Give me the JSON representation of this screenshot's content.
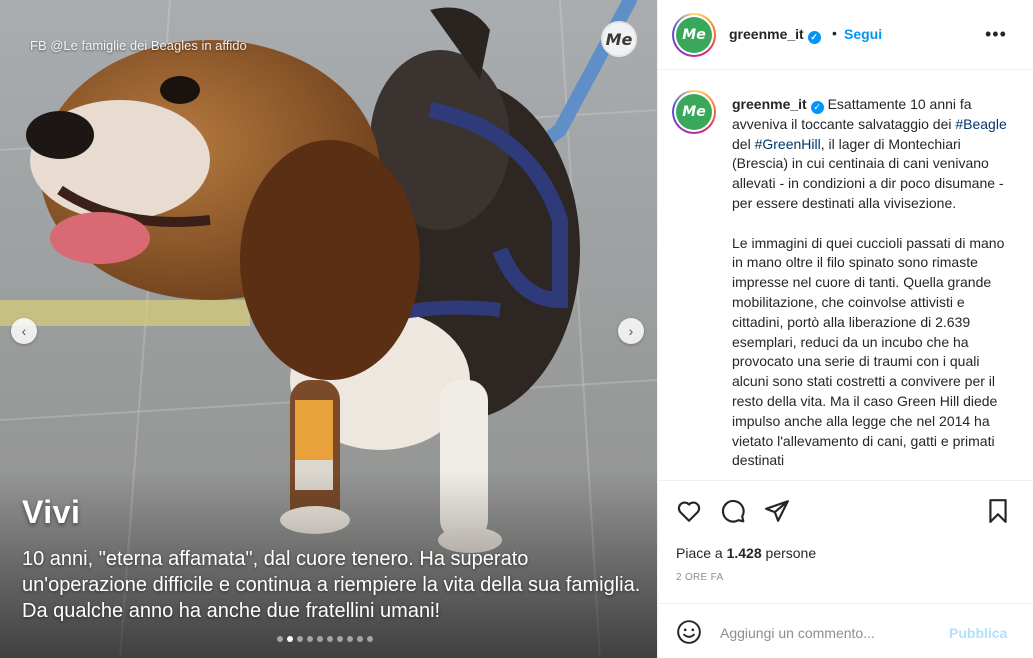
{
  "media": {
    "watermark": "FB @Le famiglie dei Beagles in affido",
    "badge": "Me",
    "caption_title": "Vivi",
    "caption_body": "10 anni, \"eterna affamata\", dal cuore tenero. Ha superato un'operazione difficile e continua a riempiere la vita della sua famiglia. Da qualche anno ha anche due fratellini umani!",
    "nav_prev": "‹",
    "nav_next": "›",
    "slide_count": 10,
    "active_slide": 2
  },
  "header": {
    "avatar_text": "Me",
    "username": "greenme_it",
    "verified_mark": "✓",
    "separator": "•",
    "follow_label": "Segui",
    "more_label": "•••"
  },
  "post_text": {
    "username": "greenme_it",
    "p1_a": "Esattamente 10 anni fa avveniva il toccante salvataggio dei ",
    "tag1": "#Beagle",
    "p1_b": " del ",
    "tag2": "#GreenHill",
    "p1_c": ", il lager di Montechiari (Brescia) in cui centinaia di cani venivano allevati - in condizioni a dir poco disumane - per essere destinati alla vivisezione.",
    "p2": "Le immagini di quei cuccioli passati di mano in mano oltre il filo spinato sono rimaste impresse nel cuore di tanti. Quella grande mobilitazione, che coinvolse attivisti e cittadini, portò alla liberazione di 2.639 esemplari, reduci da un incubo che ha provocato una serie di traumi con i quali alcuni sono stati costretti a convivere per il resto della vita. Ma il caso Green Hill diede impulso anche alla legge che nel 2014 ha vietato l'allevamento di cani, gatti e primati destinati"
  },
  "actions": {
    "like_icon": "heart-icon",
    "comment_icon": "comment-icon",
    "share_icon": "paper-plane-icon",
    "save_icon": "bookmark-icon"
  },
  "likes": {
    "prefix": "Piace a ",
    "count": "1.428",
    "suffix": " persone"
  },
  "timestamp": "2 ORE FA",
  "add_comment": {
    "placeholder": "Aggiungi un commento...",
    "publish_label": "Pubblica"
  }
}
